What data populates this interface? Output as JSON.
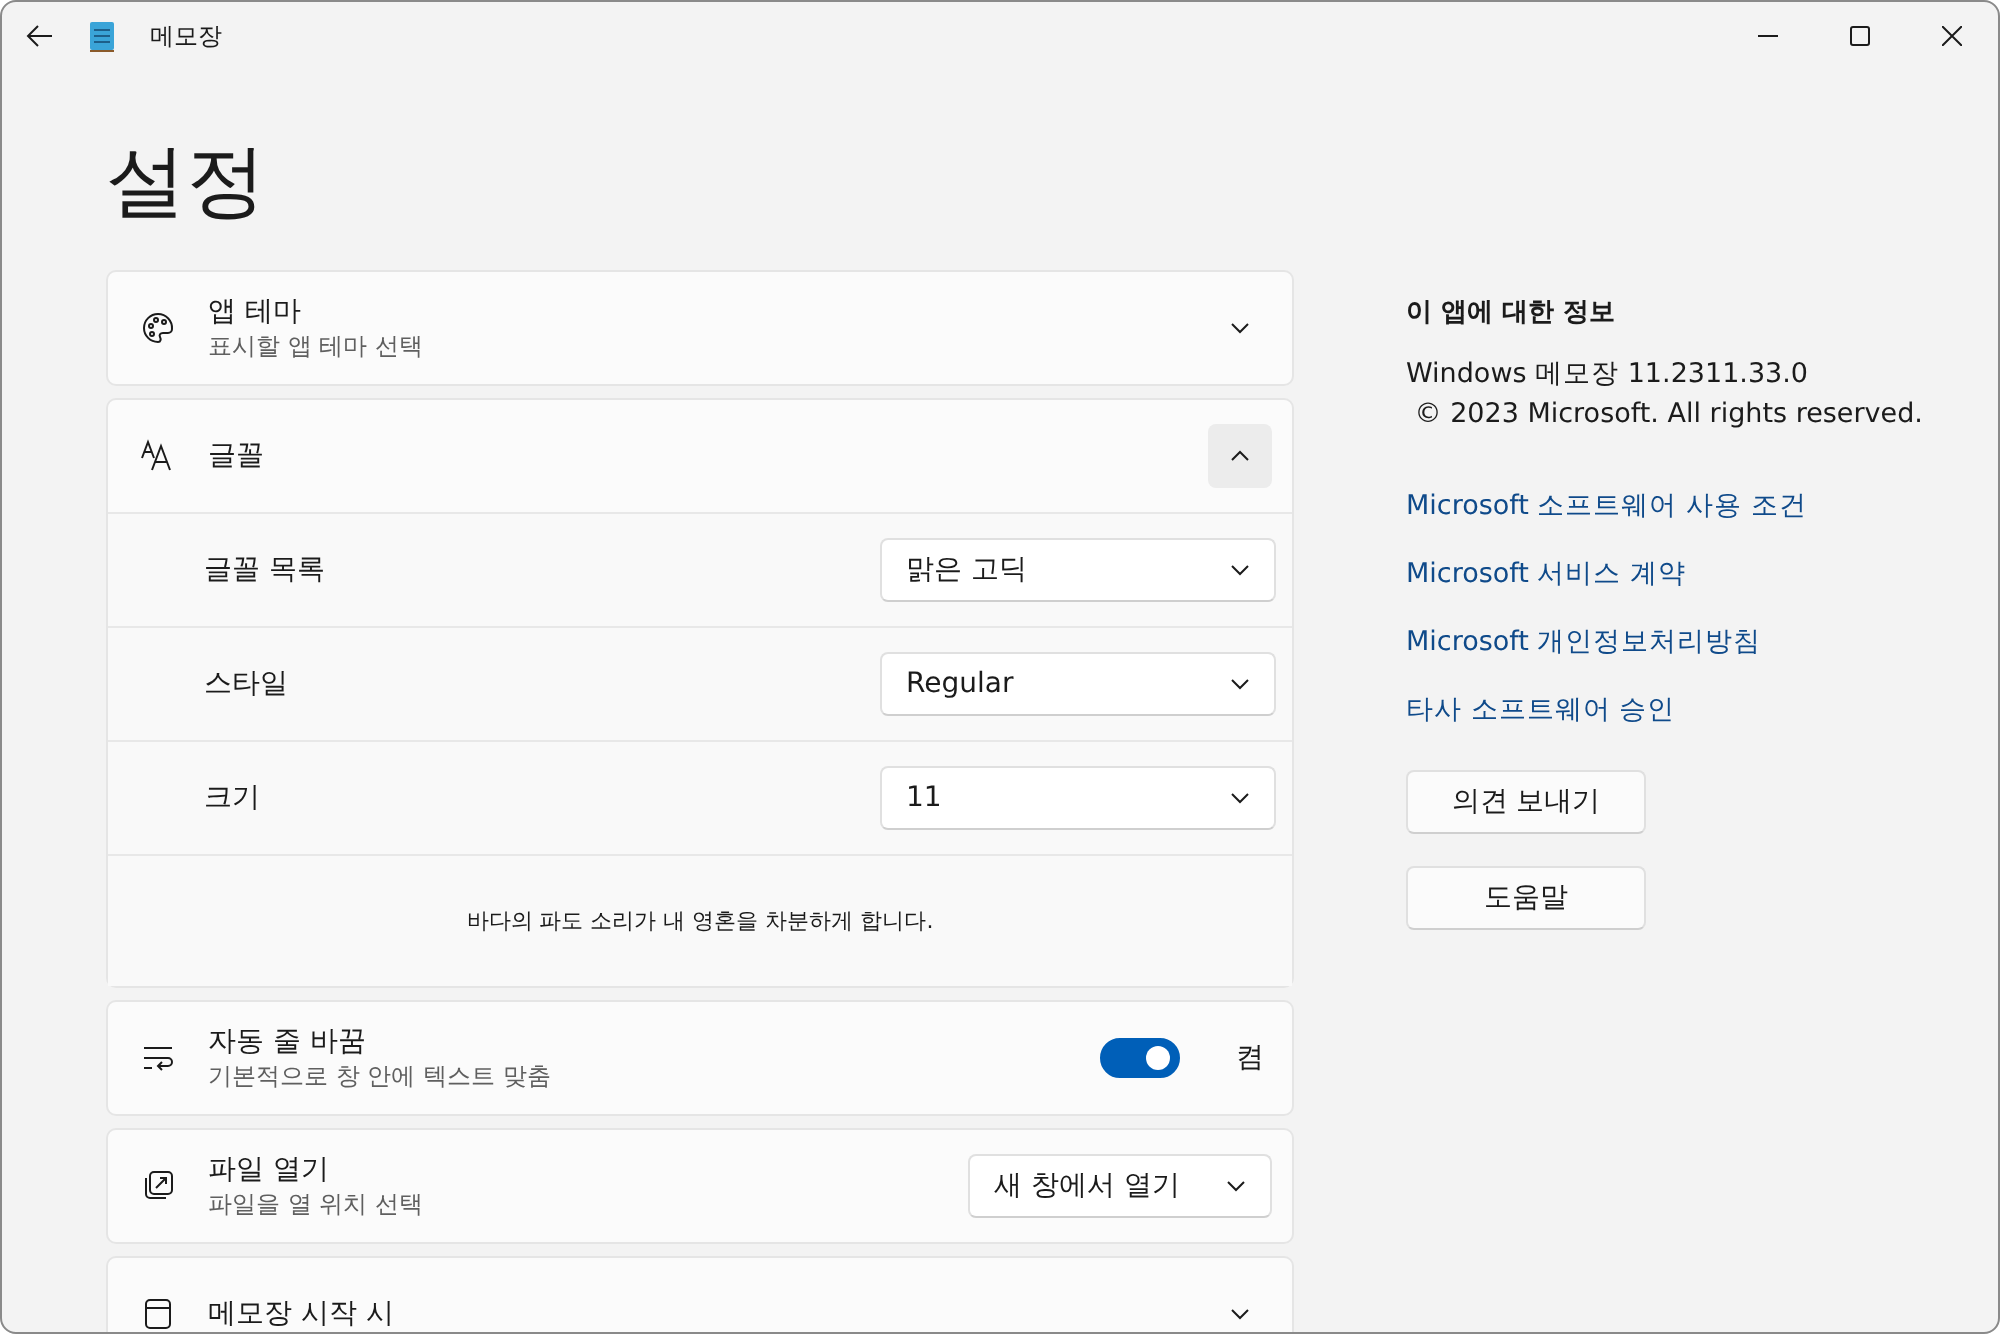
{
  "titlebar": {
    "title": "메모장"
  },
  "heading": "설정",
  "settings": [
    {
      "kind": "expander",
      "title": "앱 테마",
      "subtitle": "표시할 앱 테마 선택",
      "expanded": false
    },
    {
      "kind": "expander",
      "title": "글꼴",
      "expanded": true,
      "rows": [
        {
          "label": "글꼴 목록",
          "value": "맑은 고딕"
        },
        {
          "label": "스타일",
          "value": "Regular"
        },
        {
          "label": "크기",
          "value": "11"
        }
      ],
      "preview": "바다의 파도 소리가 내 영혼을 차분하게 합니다."
    },
    {
      "kind": "toggle",
      "title": "자동 줄 바꿈",
      "subtitle": "기본적으로 창 안에 텍스트 맞춤",
      "on": true,
      "state_label": "켬"
    },
    {
      "kind": "dropdown",
      "title": "파일 열기",
      "subtitle": "파일을 열 위치 선택",
      "value": "새 창에서 열기"
    },
    {
      "kind": "expander",
      "title": "메모장 시작 시",
      "expanded": false
    }
  ],
  "about": {
    "heading": "이 앱에 대한 정보",
    "version": "Windows 메모장 11.2311.33.0",
    "copyright": "© 2023 Microsoft. All rights reserved.",
    "links": [
      "Microsoft 소프트웨어 사용 조건",
      "Microsoft 서비스 계약",
      "Microsoft 개인정보처리방침",
      "타사 소프트웨어 승인"
    ],
    "buttons": [
      "의견 보내기",
      "도움말"
    ]
  }
}
